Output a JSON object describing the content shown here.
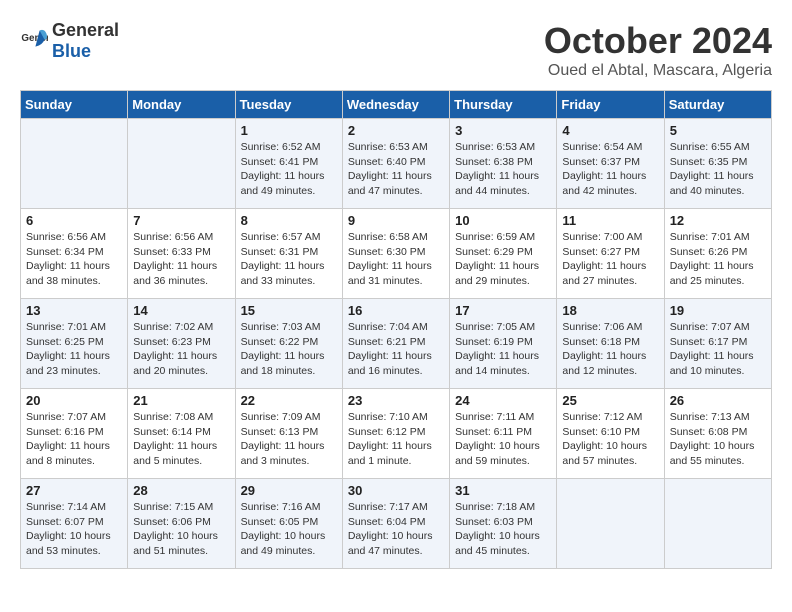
{
  "header": {
    "logo_general": "General",
    "logo_blue": "Blue",
    "month_title": "October 2024",
    "subtitle": "Oued el Abtal, Mascara, Algeria"
  },
  "weekdays": [
    "Sunday",
    "Monday",
    "Tuesday",
    "Wednesday",
    "Thursday",
    "Friday",
    "Saturday"
  ],
  "weeks": [
    [
      {
        "day": "",
        "info": ""
      },
      {
        "day": "",
        "info": ""
      },
      {
        "day": "1",
        "info": "Sunrise: 6:52 AM\nSunset: 6:41 PM\nDaylight: 11 hours and 49 minutes."
      },
      {
        "day": "2",
        "info": "Sunrise: 6:53 AM\nSunset: 6:40 PM\nDaylight: 11 hours and 47 minutes."
      },
      {
        "day": "3",
        "info": "Sunrise: 6:53 AM\nSunset: 6:38 PM\nDaylight: 11 hours and 44 minutes."
      },
      {
        "day": "4",
        "info": "Sunrise: 6:54 AM\nSunset: 6:37 PM\nDaylight: 11 hours and 42 minutes."
      },
      {
        "day": "5",
        "info": "Sunrise: 6:55 AM\nSunset: 6:35 PM\nDaylight: 11 hours and 40 minutes."
      }
    ],
    [
      {
        "day": "6",
        "info": "Sunrise: 6:56 AM\nSunset: 6:34 PM\nDaylight: 11 hours and 38 minutes."
      },
      {
        "day": "7",
        "info": "Sunrise: 6:56 AM\nSunset: 6:33 PM\nDaylight: 11 hours and 36 minutes."
      },
      {
        "day": "8",
        "info": "Sunrise: 6:57 AM\nSunset: 6:31 PM\nDaylight: 11 hours and 33 minutes."
      },
      {
        "day": "9",
        "info": "Sunrise: 6:58 AM\nSunset: 6:30 PM\nDaylight: 11 hours and 31 minutes."
      },
      {
        "day": "10",
        "info": "Sunrise: 6:59 AM\nSunset: 6:29 PM\nDaylight: 11 hours and 29 minutes."
      },
      {
        "day": "11",
        "info": "Sunrise: 7:00 AM\nSunset: 6:27 PM\nDaylight: 11 hours and 27 minutes."
      },
      {
        "day": "12",
        "info": "Sunrise: 7:01 AM\nSunset: 6:26 PM\nDaylight: 11 hours and 25 minutes."
      }
    ],
    [
      {
        "day": "13",
        "info": "Sunrise: 7:01 AM\nSunset: 6:25 PM\nDaylight: 11 hours and 23 minutes."
      },
      {
        "day": "14",
        "info": "Sunrise: 7:02 AM\nSunset: 6:23 PM\nDaylight: 11 hours and 20 minutes."
      },
      {
        "day": "15",
        "info": "Sunrise: 7:03 AM\nSunset: 6:22 PM\nDaylight: 11 hours and 18 minutes."
      },
      {
        "day": "16",
        "info": "Sunrise: 7:04 AM\nSunset: 6:21 PM\nDaylight: 11 hours and 16 minutes."
      },
      {
        "day": "17",
        "info": "Sunrise: 7:05 AM\nSunset: 6:19 PM\nDaylight: 11 hours and 14 minutes."
      },
      {
        "day": "18",
        "info": "Sunrise: 7:06 AM\nSunset: 6:18 PM\nDaylight: 11 hours and 12 minutes."
      },
      {
        "day": "19",
        "info": "Sunrise: 7:07 AM\nSunset: 6:17 PM\nDaylight: 11 hours and 10 minutes."
      }
    ],
    [
      {
        "day": "20",
        "info": "Sunrise: 7:07 AM\nSunset: 6:16 PM\nDaylight: 11 hours and 8 minutes."
      },
      {
        "day": "21",
        "info": "Sunrise: 7:08 AM\nSunset: 6:14 PM\nDaylight: 11 hours and 5 minutes."
      },
      {
        "day": "22",
        "info": "Sunrise: 7:09 AM\nSunset: 6:13 PM\nDaylight: 11 hours and 3 minutes."
      },
      {
        "day": "23",
        "info": "Sunrise: 7:10 AM\nSunset: 6:12 PM\nDaylight: 11 hours and 1 minute."
      },
      {
        "day": "24",
        "info": "Sunrise: 7:11 AM\nSunset: 6:11 PM\nDaylight: 10 hours and 59 minutes."
      },
      {
        "day": "25",
        "info": "Sunrise: 7:12 AM\nSunset: 6:10 PM\nDaylight: 10 hours and 57 minutes."
      },
      {
        "day": "26",
        "info": "Sunrise: 7:13 AM\nSunset: 6:08 PM\nDaylight: 10 hours and 55 minutes."
      }
    ],
    [
      {
        "day": "27",
        "info": "Sunrise: 7:14 AM\nSunset: 6:07 PM\nDaylight: 10 hours and 53 minutes."
      },
      {
        "day": "28",
        "info": "Sunrise: 7:15 AM\nSunset: 6:06 PM\nDaylight: 10 hours and 51 minutes."
      },
      {
        "day": "29",
        "info": "Sunrise: 7:16 AM\nSunset: 6:05 PM\nDaylight: 10 hours and 49 minutes."
      },
      {
        "day": "30",
        "info": "Sunrise: 7:17 AM\nSunset: 6:04 PM\nDaylight: 10 hours and 47 minutes."
      },
      {
        "day": "31",
        "info": "Sunrise: 7:18 AM\nSunset: 6:03 PM\nDaylight: 10 hours and 45 minutes."
      },
      {
        "day": "",
        "info": ""
      },
      {
        "day": "",
        "info": ""
      }
    ]
  ]
}
